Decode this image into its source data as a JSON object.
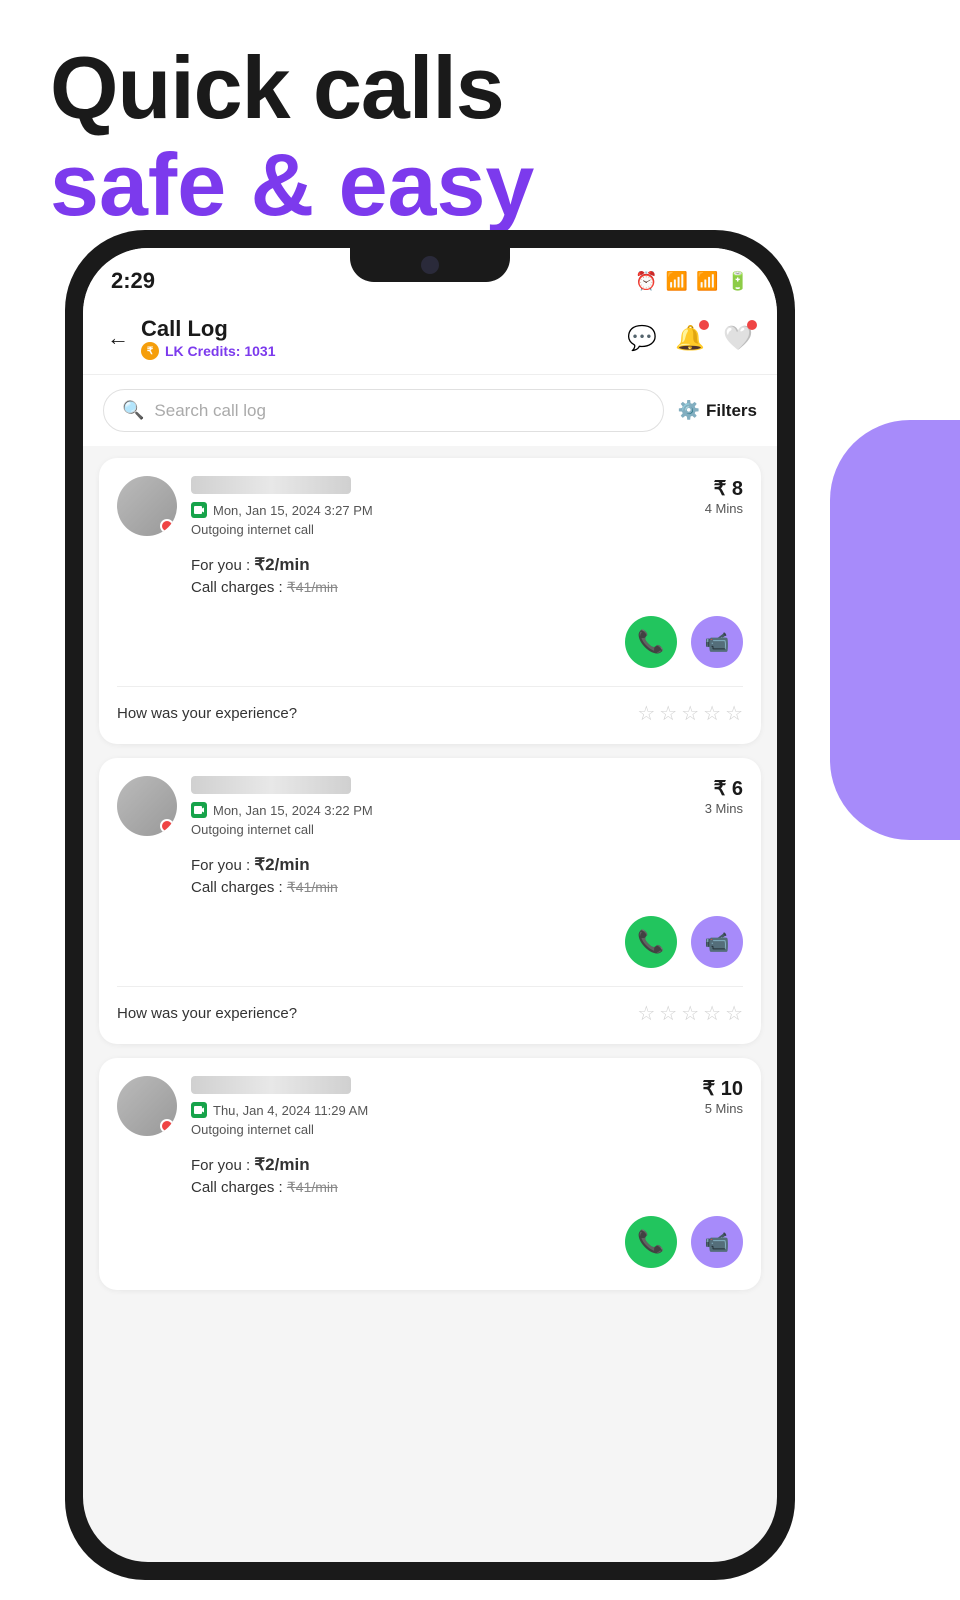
{
  "page": {
    "title_main": "Quick calls",
    "title_sub": "safe & easy"
  },
  "status_bar": {
    "time": "2:29"
  },
  "app_header": {
    "title": "Call Log",
    "credits_label": "LK Credits: 1031",
    "back_label": "←"
  },
  "search": {
    "placeholder": "Search call log",
    "filters_label": "Filters"
  },
  "call_cards": [
    {
      "id": 1,
      "date": "Mon, Jan 15, 2024 3:27 PM",
      "call_type": "Outgoing internet call",
      "cost": "₹ 8",
      "duration": "4 Mins",
      "for_you_label": "For you :",
      "for_you_price": "₹2/min",
      "charges_label": "Call charges :",
      "charges_price": "₹41/min",
      "rating_question": "How was your experience?"
    },
    {
      "id": 2,
      "date": "Mon, Jan 15, 2024 3:22 PM",
      "call_type": "Outgoing internet call",
      "cost": "₹ 6",
      "duration": "3 Mins",
      "for_you_label": "For you :",
      "for_you_price": "₹2/min",
      "charges_label": "Call charges :",
      "charges_price": "₹41/min",
      "rating_question": "How was your experience?"
    },
    {
      "id": 3,
      "date": "Thu, Jan 4, 2024 11:29 AM",
      "call_type": "Outgoing internet call",
      "cost": "₹ 10",
      "duration": "5 Mins",
      "for_you_label": "For you :",
      "for_you_price": "₹2/min",
      "charges_label": "Call charges :",
      "charges_price": "₹41/min",
      "rating_question": ""
    }
  ]
}
